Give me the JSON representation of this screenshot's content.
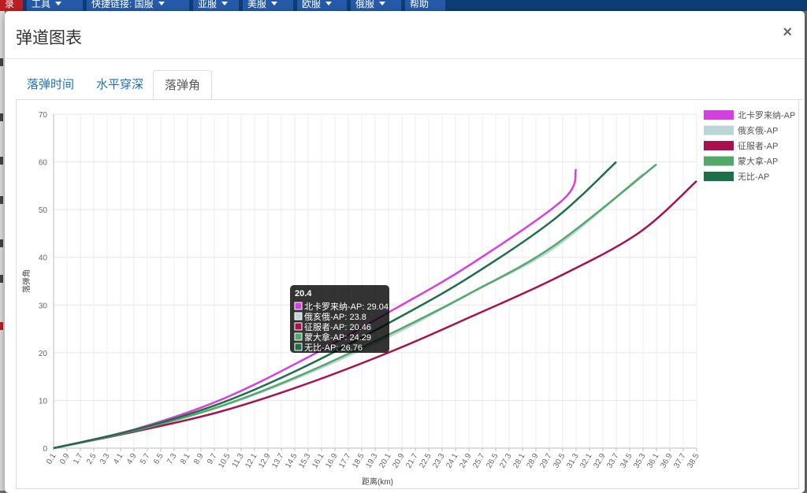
{
  "topnav": {
    "items": [
      {
        "label": "录",
        "dropdown": false,
        "color": "#b91f20"
      },
      {
        "label": "工具",
        "dropdown": true
      },
      {
        "label": "快捷链接: 国服",
        "dropdown": true
      },
      {
        "label": "亚服",
        "dropdown": true
      },
      {
        "label": "美服",
        "dropdown": true
      },
      {
        "label": "欧服",
        "dropdown": true
      },
      {
        "label": "俄服",
        "dropdown": true
      },
      {
        "label": "帮助",
        "dropdown": false
      }
    ]
  },
  "modal": {
    "title": "弹道图表",
    "close_label": "×",
    "tabs": [
      {
        "label": "落弹时间",
        "active": false
      },
      {
        "label": "水平穿深",
        "active": false
      },
      {
        "label": "落弹角",
        "active": true
      }
    ]
  },
  "chart_data": {
    "type": "line",
    "title": "",
    "xlabel": "距离(km)",
    "ylabel": "落弹角",
    "ylim": [
      0,
      70
    ],
    "yticks": [
      0,
      10,
      20,
      30,
      40,
      50,
      60,
      70
    ],
    "xticks": [
      "0.1",
      "0.9",
      "1.7",
      "2.5",
      "3.3",
      "4.1",
      "4.9",
      "5.7",
      "6.5",
      "7.3",
      "8.1",
      "8.9",
      "9.7",
      "10.5",
      "11.3",
      "12.1",
      "12.9",
      "13.7",
      "14.5",
      "15.3",
      "16.1",
      "16.9",
      "17.7",
      "18.5",
      "19.3",
      "20.1",
      "20.9",
      "21.7",
      "22.5",
      "23.3",
      "24.1",
      "24.9",
      "25.7",
      "26.5",
      "27.3",
      "28.1",
      "28.9",
      "29.7",
      "30.5",
      "31.3",
      "32.1",
      "32.9",
      "33.7",
      "34.5",
      "35.3",
      "36.1",
      "36.9",
      "37.7",
      "38.5"
    ],
    "xlim": [
      0.1,
      38.5
    ],
    "grid": true,
    "legend_position": "right",
    "series": [
      {
        "name": "北卡罗来纳-AP",
        "color": "#d63ee0",
        "x": [
          0.1,
          5,
          10,
          15,
          20.4,
          25,
          30.5,
          31.3
        ],
        "y": [
          0,
          4,
          10,
          18.5,
          29.04,
          38.5,
          52,
          58.5
        ]
      },
      {
        "name": "俄亥俄-AP",
        "color": "#bcd6d8",
        "x": [
          0.1,
          5,
          10,
          15,
          20.4,
          25,
          30,
          35.3
        ],
        "y": [
          0,
          3.7,
          8.6,
          15.2,
          23.8,
          32.5,
          42,
          57.5
        ]
      },
      {
        "name": "征服者-AP",
        "color": "#a8104f",
        "x": [
          0.1,
          5,
          10,
          15,
          20.4,
          25,
          30,
          35,
          38.5
        ],
        "y": [
          0,
          3.5,
          7.6,
          13.2,
          20.46,
          27.5,
          35.5,
          45,
          56
        ]
      },
      {
        "name": "蒙大拿-AP",
        "color": "#54a86a",
        "x": [
          0.1,
          5,
          10,
          15,
          20.4,
          25,
          30,
          36.1
        ],
        "y": [
          0,
          3.7,
          8.7,
          15.5,
          24.29,
          32.5,
          42.5,
          59.5
        ]
      },
      {
        "name": "无比-AP",
        "color": "#1f6e4a",
        "x": [
          0.1,
          5,
          10,
          15,
          20.4,
          25,
          30,
          33.7
        ],
        "y": [
          0,
          3.9,
          9.3,
          16.9,
          26.76,
          36,
          48,
          60
        ]
      }
    ],
    "tooltip": {
      "title": "20.4",
      "lines": [
        "北卡罗来纳-AP: 29.04",
        "俄亥俄-AP: 23.8",
        "征服者-AP: 20.46",
        "蒙大拿-AP: 24.29",
        "无比-AP: 26.76"
      ]
    }
  }
}
